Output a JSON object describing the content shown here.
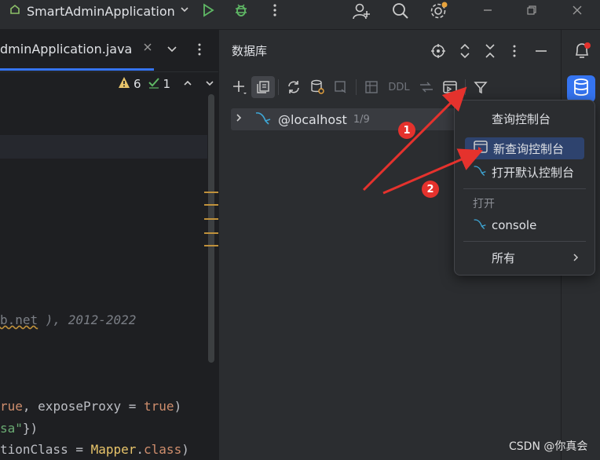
{
  "titlebar": {
    "run_config": "SmartAdminApplication",
    "icons": [
      "config-icon",
      "chevron-down-icon",
      "run-icon",
      "debug-icon",
      "more-icon",
      "add-user-icon",
      "search-icon",
      "settings-icon",
      "minimize-icon",
      "restore-icon",
      "close-icon"
    ]
  },
  "editor": {
    "tab_label": "dminApplication.java",
    "warnings": "6",
    "checks": "1",
    "code_lines": {
      "line1_link": "b.net",
      "line1_rest": " ), 2012-2022",
      "line2_kw1": "rue",
      "line2_mid": ", exposeProxy = ",
      "line2_kw2": "true",
      "line2_end": ")",
      "line3_str": "sa\"",
      "line3_end": "})",
      "line4_a": "tionClass = ",
      "line4_cls": "Mapper",
      "line4_dot": ".",
      "line4_kw": "class",
      "line4_end": ")"
    }
  },
  "db_panel": {
    "title": "数据库",
    "toolbar": {
      "ddl_label": "DDL"
    },
    "tree": [
      {
        "name": "@localhost",
        "count": "1/9"
      }
    ]
  },
  "popup": {
    "title": "查询控制台",
    "items": [
      {
        "label": "新查询控制台",
        "selected": true
      },
      {
        "label": "打开默认控制台",
        "selected": false
      }
    ],
    "section_label": "打开",
    "open_items": [
      {
        "label": "console"
      }
    ],
    "all_label": "所有"
  },
  "annotations": {
    "badge1": "1",
    "badge2": "2",
    "arrow_color": "#e5322d"
  },
  "watermark": "CSDN @你真会",
  "colors": {
    "accent": "#3574f0",
    "bg_dark": "#1e1f22",
    "panel": "#2b2d30",
    "selection": "#2e436e"
  }
}
